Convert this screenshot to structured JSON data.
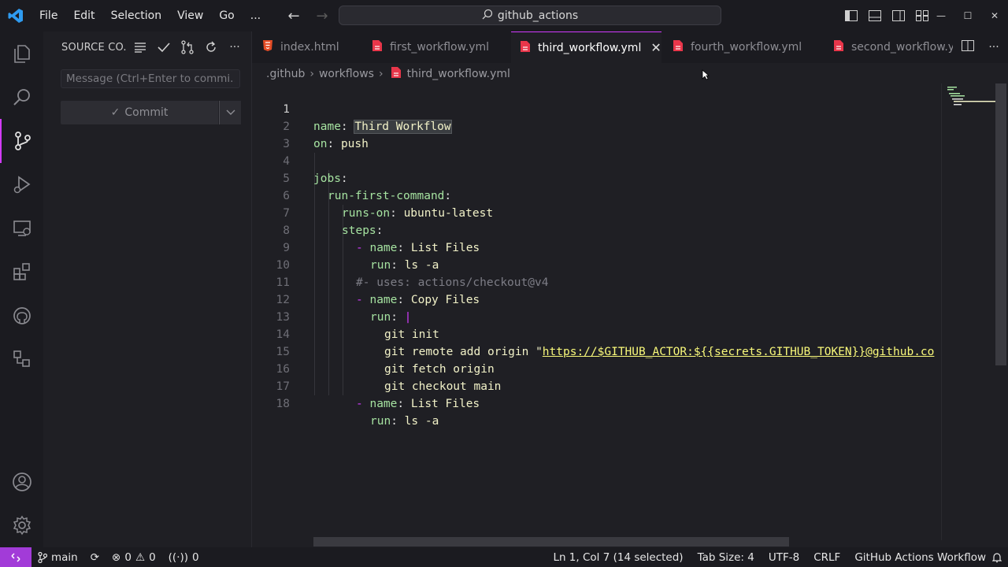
{
  "window": {
    "search_text": "github_actions"
  },
  "menu": [
    "File",
    "Edit",
    "Selection",
    "View",
    "Go",
    "..."
  ],
  "sidebar": {
    "title": "SOURCE CO...",
    "commit_placeholder": "Message (Ctrl+Enter to commi...",
    "commit_label": "Commit"
  },
  "tabs": [
    {
      "label": "index.html",
      "icon": "html-file-icon",
      "active": false
    },
    {
      "label": "first_workflow.yml",
      "icon": "yml-file-icon",
      "active": false
    },
    {
      "label": "third_workflow.yml",
      "icon": "yml-file-icon",
      "active": true
    },
    {
      "label": "fourth_workflow.yml",
      "icon": "yml-file-icon",
      "active": false
    },
    {
      "label": "second_workflow.y",
      "icon": "yml-file-icon",
      "active": false
    }
  ],
  "breadcrumb": [
    ".github",
    "workflows",
    "third_workflow.yml"
  ],
  "editor": {
    "lines": [
      {
        "n": "1"
      },
      {
        "n": "2"
      },
      {
        "n": "3"
      },
      {
        "n": "4"
      },
      {
        "n": "5"
      },
      {
        "n": "6"
      },
      {
        "n": "7"
      },
      {
        "n": "8"
      },
      {
        "n": "9"
      },
      {
        "n": "10"
      },
      {
        "n": "11"
      },
      {
        "n": "12"
      },
      {
        "n": "13"
      },
      {
        "n": "14"
      },
      {
        "n": "15"
      },
      {
        "n": "16"
      },
      {
        "n": "17"
      },
      {
        "n": "18"
      }
    ],
    "tokens": {
      "l1k": "name",
      "l1p": ": ",
      "l1v": "Third Workflow",
      "l2k": "on",
      "l2p": ": ",
      "l2v": "push",
      "l4k": "jobs",
      "l4p": ":",
      "l5k": "run-first-command",
      "l5p": ":",
      "l6k": "runs-on",
      "l6p": ": ",
      "l6v": "ubuntu-latest",
      "l7k": "steps",
      "l7p": ":",
      "l8d": "- ",
      "l8k": "name",
      "l8p": ": ",
      "l8v": "List Files",
      "l9k": "run",
      "l9p": ": ",
      "l9v": "ls -a",
      "l10c": "#- uses: actions/checkout@v4",
      "l11d": "- ",
      "l11k": "name",
      "l11p": ": ",
      "l11v": "Copy Files",
      "l12k": "run",
      "l12p": ": ",
      "l12d": "|",
      "l13v": "git init",
      "l14v": "git remote add origin ",
      "l14q": "\"",
      "l14s": "https://$GITHUB_ACTOR:${{secrets.GITHUB_TOKEN}}@github.co",
      "l15v": "git fetch origin",
      "l16v": "git checkout main",
      "l17d": "- ",
      "l17k": "name",
      "l17p": ": ",
      "l17v": "List Files",
      "l18k": "run",
      "l18p": ": ",
      "l18v": "ls -a"
    }
  },
  "status": {
    "branch": "main",
    "errors": "0",
    "warnings": "0",
    "ports": "0",
    "position": "Ln 1, Col 7 (14 selected)",
    "tab_size": "Tab Size: 4",
    "encoding": "UTF-8",
    "eol": "CRLF",
    "language": "GitHub Actions Workflow"
  },
  "colors": {
    "accent": "#d23bff",
    "remote": "#a23bd8",
    "background": "#1f1f24"
  }
}
